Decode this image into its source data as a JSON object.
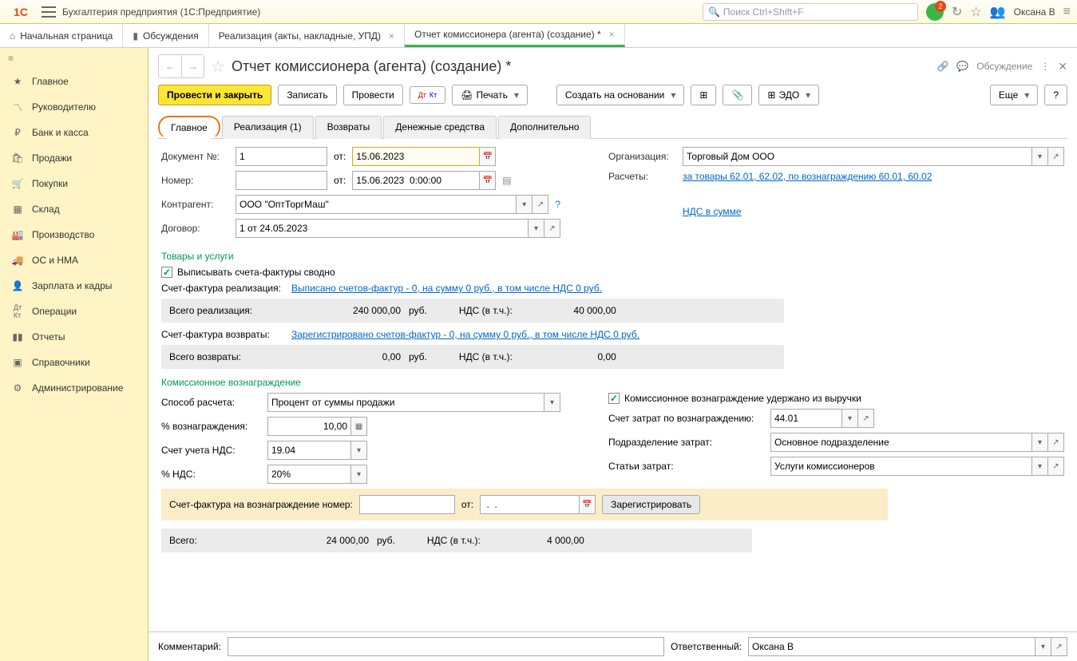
{
  "app": {
    "title": "Бухгалтерия предприятия  (1С:Предприятие)",
    "search_placeholder": "Поиск Ctrl+Shift+F",
    "notif_count": "2",
    "user": "Оксана В"
  },
  "tabs": {
    "home": "Начальная страница",
    "discussions": "Обсуждения",
    "t2": "Реализация (акты, накладные, УПД)",
    "t3": "Отчет комиссионера (агента) (создание) *"
  },
  "sidebar": {
    "items": [
      "Главное",
      "Руководителю",
      "Банк и касса",
      "Продажи",
      "Покупки",
      "Склад",
      "Производство",
      "ОС и НМА",
      "Зарплата и кадры",
      "Операции",
      "Отчеты",
      "Справочники",
      "Администрирование"
    ]
  },
  "doc": {
    "title": "Отчет комиссионера (агента) (создание) *",
    "discuss": "Обсуждение"
  },
  "toolbar": {
    "post_close": "Провести и закрыть",
    "write": "Записать",
    "post": "Провести",
    "print": "Печать",
    "create_based": "Создать на основании",
    "edo": "ЭДО",
    "more": "Еще",
    "help": "?"
  },
  "section_tabs": {
    "main": "Главное",
    "realization": "Реализация (1)",
    "returns": "Возвраты",
    "money": "Денежные средства",
    "additional": "Дополнительно"
  },
  "form": {
    "doc_no_label": "Документ №:",
    "doc_no": "1",
    "from_label": "от:",
    "doc_date": "15.06.2023",
    "number_label": "Номер:",
    "number": "",
    "number_date": "15.06.2023  0:00:00",
    "org_label": "Организация:",
    "org": "Торговый Дом ООО",
    "calc_label": "Расчеты:",
    "calc": "за товары 62.01, 62.02, по вознаграждению 60.01, 60.02",
    "counterparty_label": "Контрагент:",
    "counterparty": "ООО \"ОптТоргМаш\"",
    "vat_mode": "НДС в сумме",
    "contract_label": "Договор:",
    "contract": "1 от 24.05.2023"
  },
  "goods": {
    "title": "Товары и услуги",
    "invoice_summary_chk": "Выписывать счета-фактуры сводно",
    "sf_real_label": "Счет-фактура реализация:",
    "sf_real_link": "Выписано счетов-фактур - 0, на сумму 0 руб., в том числе НДС 0 руб.",
    "total_real_label": "Всего реализация:",
    "total_real_val": "240 000,00",
    "rub": "руб.",
    "vat_incl": "НДС (в т.ч.):",
    "total_real_vat": "40 000,00",
    "sf_ret_label": "Счет-фактура возвраты:",
    "sf_ret_link": "Зарегистрировано счетов-фактур - 0, на сумму 0 руб., в том числе НДС 0 руб.",
    "total_ret_label": "Всего возвраты:",
    "total_ret_val": "0,00",
    "total_ret_vat": "0,00"
  },
  "commission": {
    "title": "Комиссионное вознаграждение",
    "calc_method_label": "Способ расчета:",
    "calc_method": "Процент от суммы продажи",
    "withheld_chk": "Комиссионное вознаграждение удержано из выручки",
    "percent_label": "% вознаграждения:",
    "percent": "10,00",
    "exp_acc_label": "Счет затрат по вознаграждению:",
    "exp_acc": "44.01",
    "vat_acc_label": "Счет учета НДС:",
    "vat_acc": "19.04",
    "division_label": "Подразделение затрат:",
    "division": "Основное подразделение",
    "vat_rate_label": "% НДС:",
    "vat_rate": "20%",
    "exp_item_label": "Статьи затрат:",
    "exp_item": "Услуги комиссионеров",
    "sf_label": "Счет-фактура на вознаграждение номер:",
    "sf_from": "от:",
    "sf_date": " .  . ",
    "register": "Зарегистрировать",
    "total_label": "Всего:",
    "total_val": "24 000,00",
    "total_vat": "4 000,00"
  },
  "bottom": {
    "comment_label": "Комментарий:",
    "responsible_label": "Ответственный:",
    "responsible": "Оксана В"
  }
}
